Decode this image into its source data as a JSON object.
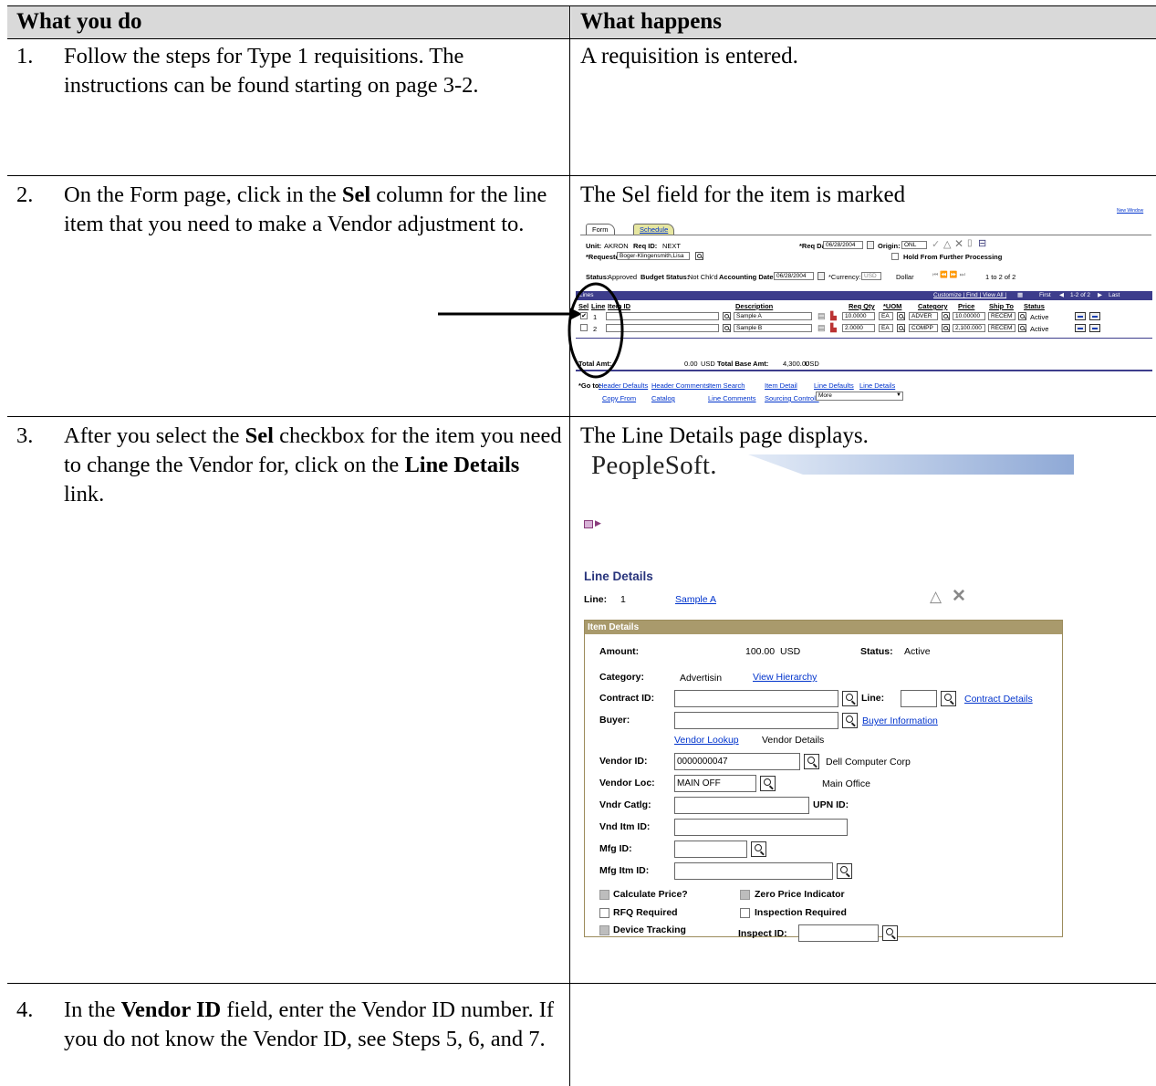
{
  "table": {
    "col1_header": "What you do",
    "col2_header": "What happens",
    "steps": [
      {
        "num": "1.",
        "text": "Follow the steps for Type 1 requisitions. The instructions can be found starting on page 3-2.",
        "result": "A requisition is entered."
      },
      {
        "num": "2.",
        "text_a": "On the Form page, click in the ",
        "text_bold": "Sel",
        "text_b": " column for the line item that you need to make a Vendor adjustment to.",
        "result": "The Sel field for the item is marked"
      },
      {
        "num": "3.",
        "text_a": "After you select the ",
        "text_bold": "Sel",
        "text_b": " checkbox for the item you need to change the Vendor for, click on the ",
        "text_bold2": "Line Details",
        "text_c": " link.",
        "result": "The Line Details page displays."
      },
      {
        "num": "4.",
        "text_a": "In the ",
        "text_bold": "Vendor ID",
        "text_b": " field, enter the Vendor ID number.  If you do not know the Vendor ID, see Steps 5, 6, and 7.",
        "result": ""
      }
    ]
  },
  "shot1": {
    "tabs": {
      "form": "Form",
      "schedule": "Schedule"
    },
    "corner_link": "New Window",
    "unit_label": "Unit:",
    "unit_value": "AKRON",
    "reqid_label": "Req ID:",
    "reqid_value": "NEXT",
    "reqdate_label": "*Req Date:",
    "reqdate_value": "06/28/2004",
    "origin_label": "Origin:",
    "origin_value": "ONL",
    "requester_label": "*Requester:",
    "requester_value": "Boger-Klingensmith,Lisa",
    "hold_label": "Hold From Further Processing",
    "status_label": "Status:",
    "status_value": "Approved",
    "budget_label": "Budget Status:",
    "budget_value": "Not Chk'd",
    "acctdate_label": "Accounting Date:",
    "acctdate_value": "06/28/2004",
    "currency_label": "*Currency:",
    "currency_value": "USD",
    "currency_name": "Dollar",
    "pager_top": "1 to 2 of 2",
    "grid_links": "Customize | Find | View All |",
    "grid_nav": "First",
    "grid_range": "1-2 of 2",
    "grid_last": "Last",
    "grid_title": "Lines",
    "col_sel": "Sel",
    "col_line": "Line",
    "col_item": "Item ID",
    "col_desc": "Description",
    "col_qty": "Req Qty",
    "col_uom": "*UOM",
    "col_cat": "Category",
    "col_price": "Price",
    "col_ship": "Ship To",
    "col_status": "Status",
    "rows": [
      {
        "sel": "✔",
        "line": "1",
        "desc": "Sample A",
        "qty": "10.0000",
        "uom": "EA",
        "cat": "ADVER",
        "price": "10.00000",
        "ship": "RECEM",
        "status": "Active"
      },
      {
        "sel": "",
        "line": "2",
        "desc": "Sample B",
        "qty": "2.0000",
        "uom": "EA",
        "cat": "COMPP",
        "price": "2,100.000",
        "ship": "RECEM",
        "status": "Active"
      }
    ],
    "total_amt_label": "Total Amt:",
    "total_amt_value": "0.00",
    "total_amt_cur": "USD",
    "total_base_label": "Total Base Amt:",
    "total_base_value": "4,300.00",
    "total_base_cur": "USD",
    "goto_label": "*Go to:",
    "goto_links": [
      "Header Defaults",
      "Header Comments",
      "Item Search",
      "Item Detail",
      "Line Defaults",
      "Line Details"
    ],
    "goto_links2": [
      "Copy From",
      "Catalog",
      "Line Comments",
      "Sourcing Controls"
    ],
    "more_value": "More"
  },
  "shot2": {
    "logo": "PeopleSoft.",
    "title": "Line Details",
    "line_label": "Line:",
    "line_value": "1",
    "line_desc_link": "Sample A",
    "section": "Item Details",
    "amount_label": "Amount:",
    "amount_value": "100.00",
    "amount_currency": "USD",
    "status_label": "Status:",
    "status_value": "Active",
    "category_label": "Category:",
    "category_value": "Advertisin",
    "view_hierarchy": "View Hierarchy",
    "contract_label": "Contract ID:",
    "line2_label": "Line:",
    "contract_details": "Contract Details",
    "buyer_label": "Buyer:",
    "buyer_info": "Buyer Information",
    "vendor_lookup": "Vendor Lookup",
    "vendor_details": "Vendor Details",
    "vendor_id_label": "Vendor ID:",
    "vendor_id_value": "0000000047",
    "vendor_name": "Dell Computer Corp",
    "vendor_loc_label": "Vendor Loc:",
    "vendor_loc_value": "MAIN OFF",
    "vendor_loc_name": "Main Office",
    "vndr_catlg_label": "Vndr Catlg:",
    "upn_label": "UPN ID:",
    "vnd_itm_label": "Vnd Itm ID:",
    "mfg_label": "Mfg ID:",
    "mfg_itm_label": "Mfg Itm ID:",
    "calc_price": "Calculate Price?",
    "zero_price": "Zero Price Indicator",
    "rfq": "RFQ Required",
    "inspection": "Inspection Required",
    "device": "Device Tracking",
    "inspect_id_label": "Inspect ID:"
  }
}
